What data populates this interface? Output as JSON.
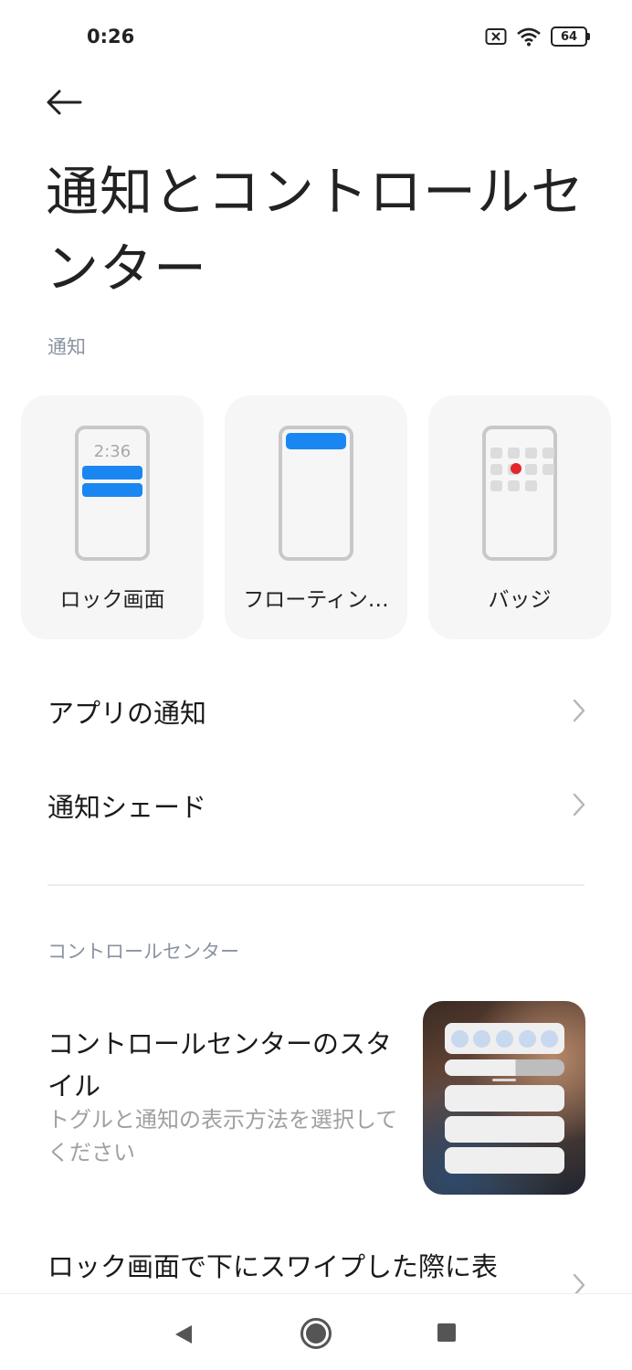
{
  "status_bar": {
    "time": "0:26",
    "battery_level": "64",
    "icons": [
      "sim-error-icon",
      "wifi-icon",
      "battery-icon"
    ]
  },
  "header": {
    "back_icon": "back-arrow-icon",
    "title": "通知とコントロールセンター"
  },
  "notifications_section": {
    "header": "通知",
    "cards": [
      {
        "label": "ロック画面",
        "illustration_clock": "2:36",
        "icon": "lock-screen-illustration"
      },
      {
        "label": "フローティン…",
        "icon": "floating-notification-illustration"
      },
      {
        "label": "バッジ",
        "icon": "badge-illustration"
      }
    ],
    "items": [
      {
        "label": "アプリの通知"
      },
      {
        "label": "通知シェード"
      }
    ]
  },
  "control_center_section": {
    "header": "コントロールセンター",
    "style_item": {
      "title": "コントロールセンターのスタイル",
      "description": "トグルと通知の表示方法を選択してください"
    },
    "lock_screen_item": {
      "label": "ロック画面で下にスワイプした際に表"
    }
  },
  "colors": {
    "accent_blue": "#1a86f2",
    "badge_red": "#e3262b",
    "section_header": "#8a93a0",
    "card_background": "#f6f6f6"
  },
  "nav_bar": {
    "icons": [
      "nav-back-icon",
      "nav-home-icon",
      "nav-recents-icon"
    ]
  }
}
